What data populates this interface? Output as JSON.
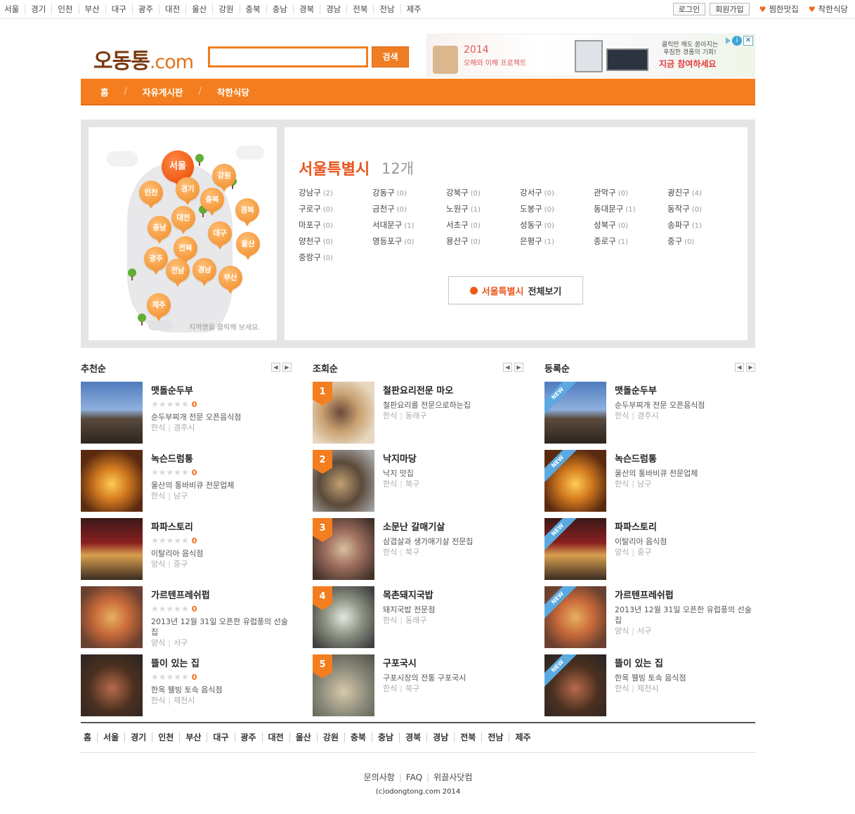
{
  "topbar": {
    "regions": [
      "서울",
      "경기",
      "인천",
      "부산",
      "대구",
      "광주",
      "대전",
      "울산",
      "강원",
      "충북",
      "충남",
      "경북",
      "경남",
      "전북",
      "전남",
      "제주"
    ],
    "login_label": "로그인",
    "signup_label": "회원가입",
    "fav_label": "찜한맛집",
    "good_label": "착한식당"
  },
  "header": {
    "logo_main": "오동통",
    "logo_suffix": ".com",
    "search_placeholder": "",
    "search_button": "검색"
  },
  "ad": {
    "year": "2014",
    "subtitle": "오해와 이해 프로젝트",
    "line1": "클릭만 해도 쏟아지는 푸짐한 경품의 기회!",
    "cta": "지금 참여하세요"
  },
  "nav": {
    "items": [
      "홈",
      "자유게시판",
      "착한식당"
    ]
  },
  "map": {
    "pins": [
      "서울",
      "강원",
      "인천",
      "경기",
      "충북",
      "대전",
      "경북",
      "충남",
      "대구",
      "울산",
      "전북",
      "광주",
      "전남",
      "경남",
      "부산",
      "제주"
    ],
    "hint": "지역명을 클릭해 보세요."
  },
  "region": {
    "title": "서울특별시",
    "count": "12개",
    "districts": [
      {
        "name": "강남구",
        "count": "(2)"
      },
      {
        "name": "강동구",
        "count": "(0)"
      },
      {
        "name": "강북구",
        "count": "(0)"
      },
      {
        "name": "강서구",
        "count": "(0)"
      },
      {
        "name": "관악구",
        "count": "(0)"
      },
      {
        "name": "광진구",
        "count": "(4)"
      },
      {
        "name": "구로구",
        "count": "(0)"
      },
      {
        "name": "금천구",
        "count": "(0)"
      },
      {
        "name": "노원구",
        "count": "(1)"
      },
      {
        "name": "도봉구",
        "count": "(0)"
      },
      {
        "name": "동대문구",
        "count": "(1)"
      },
      {
        "name": "동작구",
        "count": "(0)"
      },
      {
        "name": "마포구",
        "count": "(0)"
      },
      {
        "name": "서대문구",
        "count": "(1)"
      },
      {
        "name": "서초구",
        "count": "(0)"
      },
      {
        "name": "성동구",
        "count": "(0)"
      },
      {
        "name": "성북구",
        "count": "(0)"
      },
      {
        "name": "송파구",
        "count": "(1)"
      },
      {
        "name": "양천구",
        "count": "(0)"
      },
      {
        "name": "영등포구",
        "count": "(0)"
      },
      {
        "name": "용산구",
        "count": "(0)"
      },
      {
        "name": "은평구",
        "count": "(1)"
      },
      {
        "name": "종로구",
        "count": "(1)"
      },
      {
        "name": "중구",
        "count": "(0)"
      },
      {
        "name": "중랑구",
        "count": "(0)"
      }
    ],
    "view_all_region": "서울특별시",
    "view_all_label": "전체보기"
  },
  "lists": [
    {
      "title": "추천순",
      "items": [
        {
          "name": "맷돌순두부",
          "score": "0",
          "desc": "순두부찌개 전문 오픈음식점",
          "category": "한식",
          "area": "경주시"
        },
        {
          "name": "녹슨드럼통",
          "score": "0",
          "desc": "울산의 통바비큐 전문업체",
          "category": "한식",
          "area": "남구"
        },
        {
          "name": "파파스토리",
          "score": "0",
          "desc": "이탈리아 음식점",
          "category": "양식",
          "area": "중구"
        },
        {
          "name": "가르텐프레쉬펍",
          "score": "0",
          "desc": "2013년 12월 31일 오픈한 유럽풍의 선술집",
          "category": "양식",
          "area": "서구"
        },
        {
          "name": "뜰이 있는 집",
          "score": "0",
          "desc": "한옥 웰빙 토속 음식점",
          "category": "한식",
          "area": "제천시"
        }
      ]
    },
    {
      "title": "조회순",
      "items": [
        {
          "rank": "1",
          "name": "철판요리전문 마오",
          "desc": "철판요리를 전문으로하는집",
          "category": "한식",
          "area": "동래구"
        },
        {
          "rank": "2",
          "name": "낙지마당",
          "desc": "낙지 맛집",
          "category": "한식",
          "area": "북구"
        },
        {
          "rank": "3",
          "name": "소문난 갈매기살",
          "desc": "삼겹살과 생가매기살 전문집",
          "category": "한식",
          "area": "북구"
        },
        {
          "rank": "4",
          "name": "목촌돼지국밥",
          "desc": "돼지국밥 전문점",
          "category": "한식",
          "area": "동래구"
        },
        {
          "rank": "5",
          "name": "구포국시",
          "desc": "구포시장의 전통 구포국시",
          "category": "한식",
          "area": "북구"
        }
      ]
    },
    {
      "title": "등록순",
      "badge": "NEW",
      "items": [
        {
          "name": "맷돌순두부",
          "desc": "순두부찌개 전문 오픈음식점",
          "category": "한식",
          "area": "경주시"
        },
        {
          "name": "녹슨드럼통",
          "desc": "울산의 통바비큐 전문업체",
          "category": "한식",
          "area": "남구"
        },
        {
          "name": "파파스토리",
          "desc": "이탈리아 음식점",
          "category": "양식",
          "area": "중구"
        },
        {
          "name": "가르텐프레쉬펍",
          "desc": "2013년 12월 31일 오픈한 유럽풍의 선술집",
          "category": "양식",
          "area": "서구"
        },
        {
          "name": "뜰이 있는 집",
          "desc": "한옥 웰빙 토속 음식점",
          "category": "한식",
          "area": "제천시"
        }
      ]
    }
  ],
  "footer": {
    "nav": [
      "홈",
      "서울",
      "경기",
      "인천",
      "부산",
      "대구",
      "광주",
      "대전",
      "울산",
      "강원",
      "충북",
      "충남",
      "경북",
      "경남",
      "전북",
      "전남",
      "제주"
    ],
    "links": [
      "문의사항",
      "FAQ",
      "위끌사닷컴"
    ],
    "copyright": "(c)odongtong.com 2014"
  }
}
